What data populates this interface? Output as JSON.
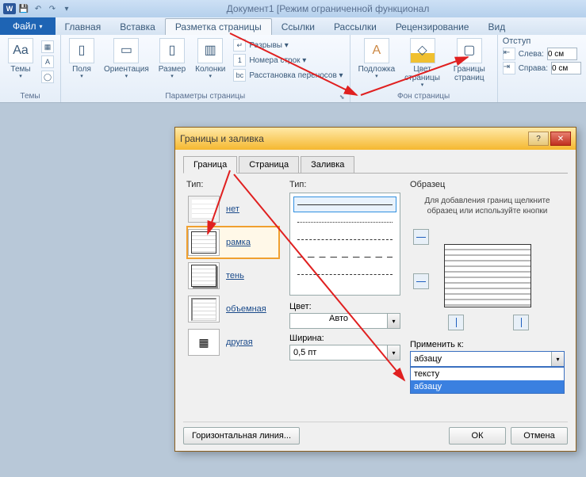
{
  "title": "Документ1 [Режим ограниченной функционал",
  "qat": {
    "save": "💾",
    "undo": "↶",
    "redo": "↷"
  },
  "tabs": {
    "file": "Файл",
    "items": [
      "Главная",
      "Вставка",
      "Разметка страницы",
      "Ссылки",
      "Рассылки",
      "Рецензирование",
      "Вид"
    ],
    "active": 2
  },
  "ribbon": {
    "themes": {
      "label": "Темы",
      "btn": "Темы"
    },
    "page": {
      "label": "Параметры страницы",
      "fields": "Поля",
      "orientation": "Ориентация",
      "size": "Размер",
      "columns": "Колонки",
      "breaks": "Разрывы ▾",
      "lineNumbers": "Номера строк ▾",
      "hyphenation": "Расстановка переносов ▾"
    },
    "bg": {
      "label": "Фон страницы",
      "watermark": "Подложка",
      "color": "Цвет страницы",
      "borders": "Границы страниц"
    },
    "indent": {
      "label": "Отступ",
      "left": "Слева:",
      "right": "Справа:",
      "leftVal": "0 см",
      "rightVal": "0 см"
    }
  },
  "dialog": {
    "title": "Границы и заливка",
    "tabs": [
      "Граница",
      "Страница",
      "Заливка"
    ],
    "activeTab": 0,
    "typeLabel": "Тип:",
    "types": [
      "нет",
      "рамка",
      "тень",
      "объемная",
      "другая"
    ],
    "selectedType": 1,
    "styleLabel": "Тип:",
    "colorLabel": "Цвет:",
    "colorValue": "Авто",
    "widthLabel": "Ширина:",
    "widthValue": "0,5 пт",
    "previewLabel": "Образец",
    "previewHint": "Для добавления границ щелкните образец или используйте кнопки",
    "applyLabel": "Применить к:",
    "applyValue": "абзацу",
    "applyOptions": [
      "тексту",
      "абзацу"
    ],
    "hlineBtn": "Горизонтальная линия...",
    "ok": "ОК",
    "cancel": "Отмена"
  }
}
